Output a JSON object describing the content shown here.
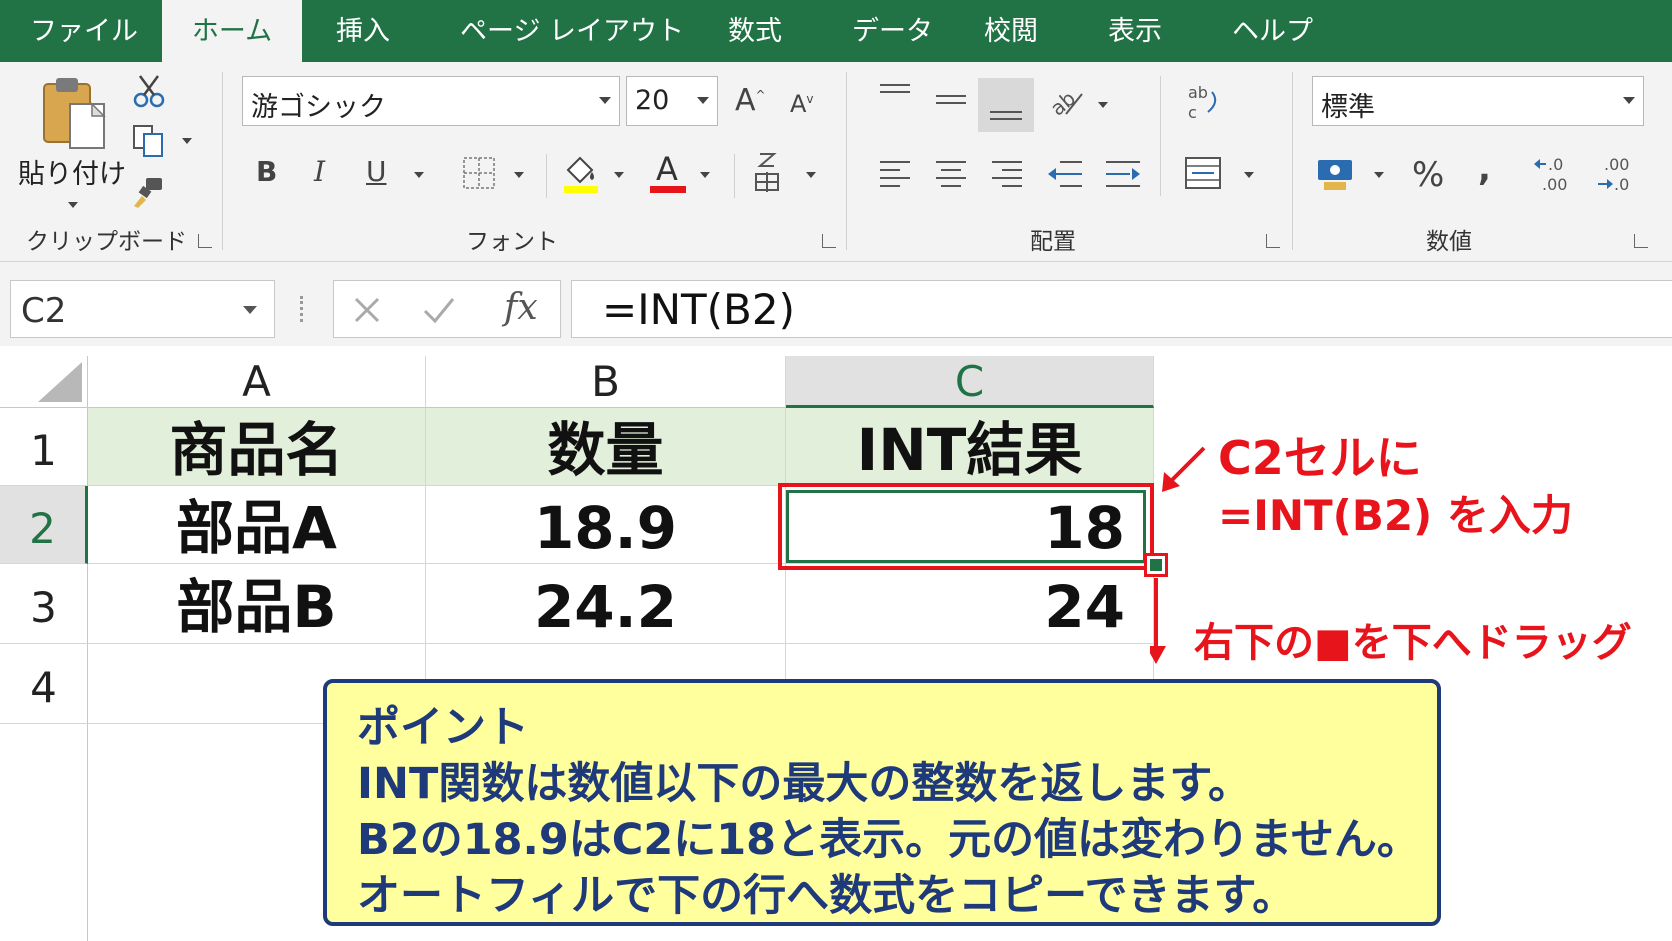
{
  "tabs": [
    "ファイル",
    "ホーム",
    "挿入",
    "ページ レイアウト",
    "数式",
    "データ",
    "校閲",
    "表示",
    "ヘルプ"
  ],
  "active_tab": "ホーム",
  "ribbon": {
    "clipboard": {
      "paste_label": "貼り付け",
      "group_label": "クリップボード"
    },
    "font": {
      "font_name": "游ゴシック",
      "font_size": "20",
      "group_label": "フォント",
      "bold": "B",
      "italic": "I",
      "underline": "U",
      "grow": "A",
      "shrink": "A",
      "font_color": "A"
    },
    "alignment": {
      "group_label": "配置"
    },
    "number": {
      "format": "標準",
      "percent": "%",
      "comma": ",",
      "group_label": "数値"
    }
  },
  "formula_bar": {
    "name_box": "C2",
    "fx": "fx",
    "formula": "=INT(B2)"
  },
  "grid": {
    "columns": [
      "A",
      "B",
      "C"
    ],
    "selected_column": "C",
    "rows": [
      "1",
      "2",
      "3",
      "4"
    ],
    "selected_row": "2",
    "cells": [
      [
        "商品名",
        "数量",
        "INT結果"
      ],
      [
        "部品A",
        "18.9",
        "18"
      ],
      [
        "部品B",
        "24.2",
        "24"
      ]
    ]
  },
  "annotations": {
    "note1_line1": "C2セルに",
    "note1_line2": "=INT(B2) を入力",
    "note2": "右下の■を下へドラッグ",
    "accent_red": "#e8141b",
    "excel_green": "#217346"
  },
  "point_box": {
    "lines": [
      "ポイント",
      "INT関数は数値以下の最大の整数を返します。",
      "B2の18.9はC2に18と表示。元の値は変わりません。",
      "オートフィルで下の行へ数式をコピーできます。"
    ]
  }
}
